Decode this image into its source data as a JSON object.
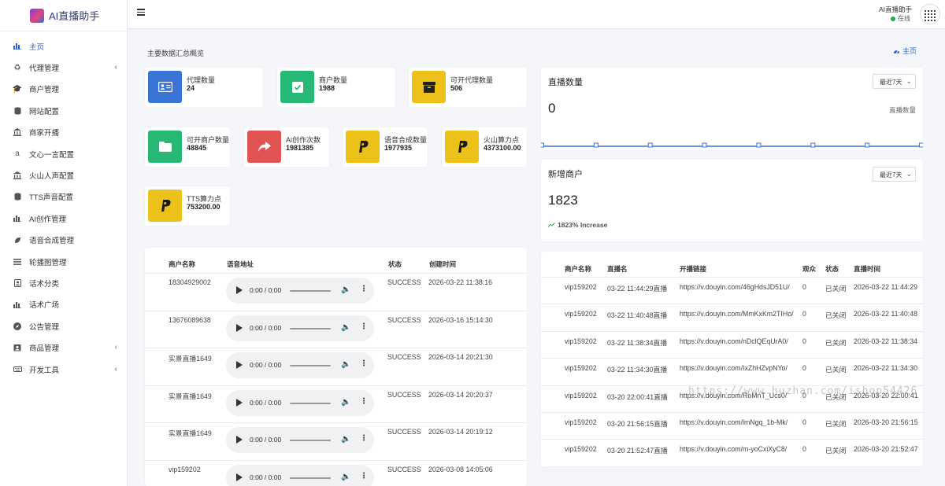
{
  "brand": {
    "name": "AI直播助手"
  },
  "sidebar": {
    "items": [
      {
        "label": "主页",
        "icon": "bar-chart-icon"
      },
      {
        "label": "代理管理",
        "icon": "recycle-icon",
        "chevron": true
      },
      {
        "label": "商户管理",
        "icon": "graduation-cap-icon"
      },
      {
        "label": "网站配置",
        "icon": "database-icon"
      },
      {
        "label": "商家开播",
        "icon": "bank-icon"
      },
      {
        "label": "文心一言配置",
        "icon": "amazon-icon"
      },
      {
        "label": "火山人声配置",
        "icon": "bank-icon"
      },
      {
        "label": "TTS声音配置",
        "icon": "database-icon"
      },
      {
        "label": "AI创作管理",
        "icon": "bar-chart-icon"
      },
      {
        "label": "语音合成管理",
        "icon": "leaf-icon"
      },
      {
        "label": "轮播图管理",
        "icon": "list-icon"
      },
      {
        "label": "话术分类",
        "icon": "address-book-icon"
      },
      {
        "label": "话术广场",
        "icon": "bar-chart-icon"
      },
      {
        "label": "公告管理",
        "icon": "compass-icon"
      },
      {
        "label": "商品管理",
        "icon": "user-card-icon",
        "chevron": true
      },
      {
        "label": "开发工具",
        "icon": "keyboard-icon",
        "chevron": true
      }
    ]
  },
  "topbar": {
    "user_name": "AI直播助手",
    "status": "在线"
  },
  "page": {
    "header": "主要数据汇总概览",
    "breadcrumb": "主页"
  },
  "stats": [
    {
      "label": "代理数量",
      "value": "24",
      "color": "#3a74d4",
      "icon": "id-card-icon"
    },
    {
      "label": "商户数量",
      "value": "1988",
      "color": "#28b876",
      "icon": "check-square-icon"
    },
    {
      "label": "可开代理数量",
      "value": "506",
      "color": "#ecc21a",
      "icon": "archive-icon"
    },
    {
      "label": "可开商户数量",
      "value": "48845",
      "color": "#28b876",
      "icon": "folder-icon"
    },
    {
      "label": "Ai创作次数",
      "value": "1981385",
      "color": "#e15454",
      "icon": "share-icon"
    },
    {
      "label": "语音合成数量",
      "value": "1977935",
      "color": "#ecc21a",
      "icon": "paypal-icon"
    },
    {
      "label": "火山算力点",
      "value": "4373100.00",
      "color": "#ecc21a",
      "icon": "paypal-icon"
    },
    {
      "label": "TTS算力点",
      "value": "753200.00",
      "color": "#ecc21a",
      "icon": "paypal-icon"
    }
  ],
  "live_panel": {
    "title": "直播数量",
    "select": "最近7天",
    "value": "0",
    "legend": "直播数量"
  },
  "chart_data": {
    "type": "line",
    "title": "直播数量",
    "series": [
      {
        "name": "直播数量",
        "values": [
          0,
          0,
          0,
          0,
          0,
          0,
          0,
          0
        ]
      }
    ],
    "ylim": [
      0,
      1
    ]
  },
  "merchant_panel": {
    "title": "新增商户",
    "select": "最近7天",
    "value": "1823",
    "increase": "1823% Increase"
  },
  "voice_table": {
    "headers": [
      "商户名称",
      "语音地址",
      "状态",
      "创建时间"
    ],
    "audio_time": "0:00 / 0:00",
    "rows": [
      {
        "name": "18304929002",
        "status": "SUCCESS",
        "time": "2026-03-22 11:38:16"
      },
      {
        "name": "13676089638",
        "status": "SUCCESS",
        "time": "2026-03-16 15:14:30"
      },
      {
        "name": "实景直播1649",
        "status": "SUCCESS",
        "time": "2026-03-14 20:21:30"
      },
      {
        "name": "实景直播1649",
        "status": "SUCCESS",
        "time": "2026-03-14 20:20:37"
      },
      {
        "name": "实景直播1649",
        "status": "SUCCESS",
        "time": "2026-03-14 20:19:12"
      },
      {
        "name": "vip159202",
        "status": "SUCCESS",
        "time": "2026-03-08 14:05:06"
      }
    ]
  },
  "live_table": {
    "headers": [
      "商户名称",
      "直播名",
      "开播链接",
      "观众",
      "状态",
      "直播时间"
    ],
    "rows": [
      {
        "name": "vip159202",
        "live": "03-22 11:44:29直播",
        "link": "https://v.douyin.com/46gHdsJD51U/",
        "viewers": "0",
        "status": "已关闭",
        "time": "2026-03-22 11:44:29"
      },
      {
        "name": "vip159202",
        "live": "03-22 11:40:48直播",
        "link": "https://v.douyin.com/MmKxKm2TIHo/",
        "viewers": "0",
        "status": "已关闭",
        "time": "2026-03-22 11:40:48"
      },
      {
        "name": "vip159202",
        "live": "03-22 11:38:34直播",
        "link": "https://v.douyin.com/nDclQEqUrA0/",
        "viewers": "0",
        "status": "已关闭",
        "time": "2026-03-22 11:38:34"
      },
      {
        "name": "vip159202",
        "live": "03-22 11:34:30直播",
        "link": "https://v.douyin.com/IxZhHZvpNYo/",
        "viewers": "0",
        "status": "已关闭",
        "time": "2026-03-22 11:34:30"
      },
      {
        "name": "vip159202",
        "live": "03-20 22:00:41直播",
        "link": "https://v.douyin.com/RoMnT_Ucs0/",
        "viewers": "0",
        "status": "已关闭",
        "time": "2026-03-20 22:00:41"
      },
      {
        "name": "vip159202",
        "live": "03-20 21:56:15直播",
        "link": "https://v.douyin.com/lmNgq_1b-Mk/",
        "viewers": "0",
        "status": "已关闭",
        "time": "2026-03-20 21:56:15"
      },
      {
        "name": "vip159202",
        "live": "03-20 21:52:47直播",
        "link": "https://v.douyin.com/m-yoCxiXyC8/",
        "viewers": "0",
        "status": "已关闭",
        "time": "2026-03-20 21:52:47"
      }
    ]
  },
  "watermark": "https://www.huzhan.com/ishop54426"
}
